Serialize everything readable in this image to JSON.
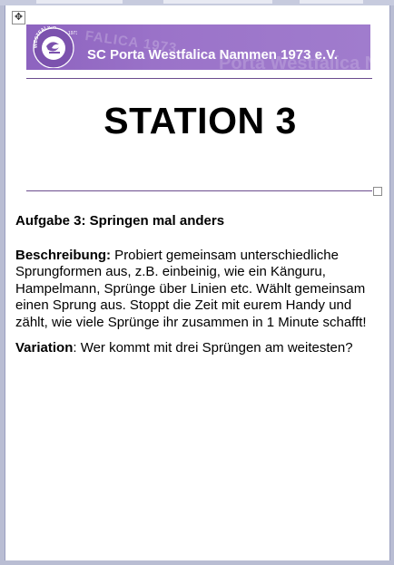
{
  "banner": {
    "arc_text": "WESTFALICA",
    "arc_year": "1973",
    "ghost_text": "FALICA 1973",
    "ghost_text_2": "Porta Westfalica Namm",
    "club_name": "SC Porta Westfalica Nammen 1973 e.V.",
    "colors": {
      "banner": "#9b73c9",
      "rule": "#6b4c8e"
    }
  },
  "station": {
    "title": "STATION 3"
  },
  "task": {
    "title": "Aufgabe 3: Springen mal anders",
    "description_label": "Beschreibung:",
    "description_text": " Probiert gemeinsam unterschiedliche Sprungformen aus, z.B. einbeinig, wie ein Känguru, Hampelmann, Sprünge über Linien etc. Wählt gemeinsam einen Sprung aus. Stoppt die Zeit mit eurem Handy und zählt, wie viele Sprünge ihr zusammen in 1 Minute schafft!",
    "variation_label": "Variation",
    "variation_text": ": Wer kommt mit drei Sprüngen am weitesten?"
  },
  "icons": {
    "move_handle": "move-arrows-icon",
    "logo": "club-logo-icon"
  }
}
